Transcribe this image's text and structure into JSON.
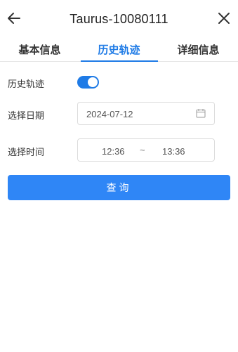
{
  "header": {
    "title": "Taurus-10080111"
  },
  "tabs": [
    {
      "label": "基本信息",
      "active": false
    },
    {
      "label": "历史轨迹",
      "active": true
    },
    {
      "label": "详细信息",
      "active": false
    }
  ],
  "form": {
    "history_label": "历史轨迹",
    "history_enabled": true,
    "date_label": "选择日期",
    "date_value": "2024-07-12",
    "time_label": "选择时间",
    "time_start": "12:36",
    "time_separator": "~",
    "time_end": "13:36"
  },
  "query_button": "查询",
  "icons": {
    "back": "arrow-left-icon",
    "close": "close-icon",
    "calendar": "calendar-icon"
  },
  "colors": {
    "accent": "#1f7be6",
    "button": "#2f86f6"
  }
}
